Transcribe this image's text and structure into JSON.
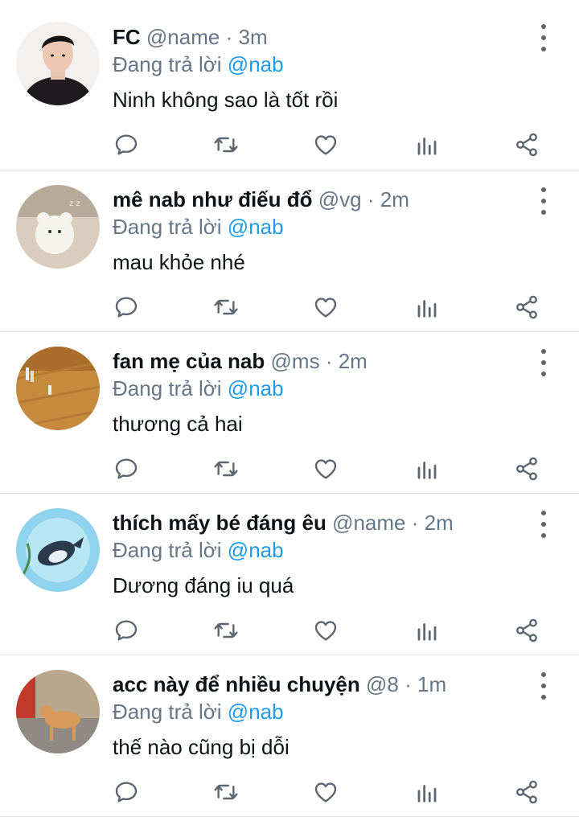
{
  "replying_prefix": "Đang trả lời",
  "replies": [
    {
      "name": "FC",
      "handle": "@name",
      "separator": "·",
      "time": "3m",
      "replying_to": "@nab",
      "text": "Ninh không sao là tốt rồi"
    },
    {
      "name": "mê nab như điếu đổ",
      "handle": "@vg",
      "separator": "·",
      "time": "2m",
      "replying_to": "@nab",
      "text": "mau khỏe nhé"
    },
    {
      "name": "fan mẹ của nab",
      "handle": "@ms",
      "separator": "·",
      "time": "2m",
      "replying_to": "@nab",
      "text": "thương cả hai"
    },
    {
      "name": "thích mấy bé đáng êu",
      "handle": "@name",
      "separator": "·",
      "time": "2m",
      "replying_to": "@nab",
      "text": "Dương đáng iu quá"
    },
    {
      "name": "acc này để nhiều chuyện",
      "handle": "@8",
      "separator": "·",
      "time": "1m",
      "replying_to": "@nab",
      "text": "thế nào cũng bị dỗi"
    }
  ],
  "icons": {
    "more": "more-vertical-icon",
    "reply": "comment-bubble-icon",
    "retweet": "retweet-icon",
    "like": "heart-icon",
    "stats": "analytics-bars-icon",
    "share": "share-nodes-icon"
  },
  "colors": {
    "mention": "#1d9bf0",
    "secondary_text": "#657786",
    "icon": "#5b6670",
    "divider": "#e3e6e8"
  }
}
